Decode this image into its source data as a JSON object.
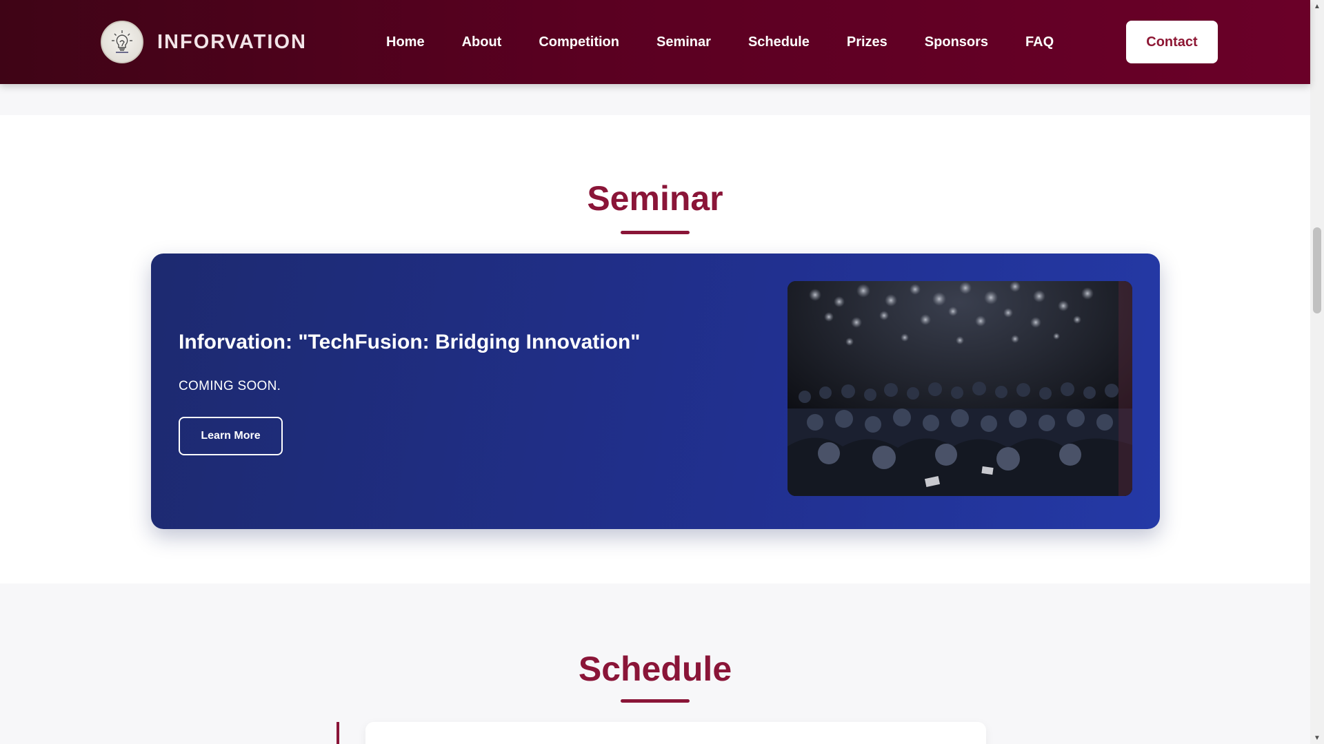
{
  "navbar": {
    "brand": "INFORVATION",
    "logo_icon": "lightbulb-logo-icon",
    "links": [
      "Home",
      "About",
      "Competition",
      "Seminar",
      "Schedule",
      "Prizes",
      "Sponsors",
      "FAQ"
    ],
    "contact_label": "Contact"
  },
  "seminar": {
    "title": "Seminar",
    "card": {
      "heading": "Inforvation: \"TechFusion: Bridging Innovation\"",
      "text": "COMING SOON.",
      "button_label": "Learn More",
      "image": "seminar-audience-photo"
    }
  },
  "schedule": {
    "title": "Schedule"
  },
  "colors": {
    "accent": "#8a1538",
    "nav_bg": "#5a0021",
    "card_bg": "#213090"
  }
}
